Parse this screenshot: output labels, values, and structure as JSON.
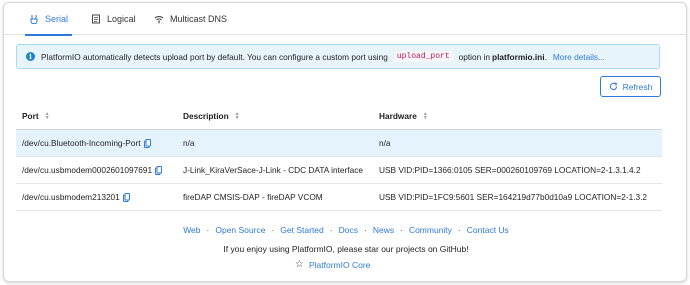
{
  "tabs": [
    {
      "label": "Serial",
      "icon": "serial-icon",
      "active": true
    },
    {
      "label": "Logical",
      "icon": "logical-icon",
      "active": false
    },
    {
      "label": "Multicast DNS",
      "icon": "wifi-icon",
      "active": false
    }
  ],
  "banner": {
    "icon": "info-icon",
    "text_before": "PlatformIO automatically detects upload port by default. You can configure a custom port using",
    "code": "upload_port",
    "text_middle": "option in",
    "file": "platformio.ini",
    "text_after": ".",
    "link": "More details..."
  },
  "refresh": {
    "label": "Refresh",
    "icon": "refresh-icon"
  },
  "table": {
    "columns": [
      "Port",
      "Description",
      "Hardware"
    ],
    "rows": [
      {
        "port": "/dev/cu.Bluetooth-Incoming-Port",
        "description": "n/a",
        "hardware": "n/a",
        "selected": true
      },
      {
        "port": "/dev/cu.usbmodem0002601097691",
        "description": "J-Link_KiraVerSace-J-Link - CDC DATA interface",
        "hardware": "USB VID:PID=1366:0105 SER=000260109769 LOCATION=2-1.3.1.4.2",
        "selected": false
      },
      {
        "port": "/dev/cu.usbmodem213201",
        "description": "fireDAP CMSIS-DAP - fireDAP VCOM",
        "hardware": "USB VID:PID=1FC9:5601 SER=164219d77b0d10a9 LOCATION=2-1.3.2",
        "selected": false
      }
    ]
  },
  "footer": {
    "links": [
      "Web",
      "Open Source",
      "Get Started",
      "Docs",
      "News",
      "Community",
      "Contact Us"
    ],
    "separator": "·",
    "message": "If you enjoy using PlatformIO, please star our projects on GitHub!",
    "star_link": "PlatformIO Core"
  },
  "colors": {
    "accent": "#2f7ad6",
    "banner_bg": "#e7f5fb",
    "selected_row": "#e4f3fc"
  }
}
